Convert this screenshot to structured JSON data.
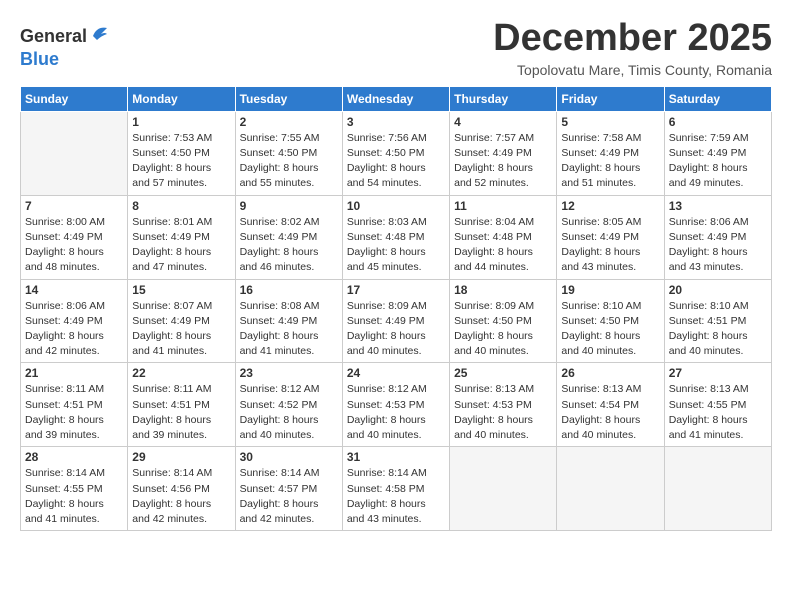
{
  "logo": {
    "general": "General",
    "blue": "Blue"
  },
  "title": "December 2025",
  "subtitle": "Topolovatu Mare, Timis County, Romania",
  "headers": [
    "Sunday",
    "Monday",
    "Tuesday",
    "Wednesday",
    "Thursday",
    "Friday",
    "Saturday"
  ],
  "weeks": [
    [
      {
        "day": "",
        "sunrise": "",
        "sunset": "",
        "daylight": ""
      },
      {
        "day": "1",
        "sunrise": "Sunrise: 7:53 AM",
        "sunset": "Sunset: 4:50 PM",
        "daylight": "Daylight: 8 hours and 57 minutes."
      },
      {
        "day": "2",
        "sunrise": "Sunrise: 7:55 AM",
        "sunset": "Sunset: 4:50 PM",
        "daylight": "Daylight: 8 hours and 55 minutes."
      },
      {
        "day": "3",
        "sunrise": "Sunrise: 7:56 AM",
        "sunset": "Sunset: 4:50 PM",
        "daylight": "Daylight: 8 hours and 54 minutes."
      },
      {
        "day": "4",
        "sunrise": "Sunrise: 7:57 AM",
        "sunset": "Sunset: 4:49 PM",
        "daylight": "Daylight: 8 hours and 52 minutes."
      },
      {
        "day": "5",
        "sunrise": "Sunrise: 7:58 AM",
        "sunset": "Sunset: 4:49 PM",
        "daylight": "Daylight: 8 hours and 51 minutes."
      },
      {
        "day": "6",
        "sunrise": "Sunrise: 7:59 AM",
        "sunset": "Sunset: 4:49 PM",
        "daylight": "Daylight: 8 hours and 49 minutes."
      }
    ],
    [
      {
        "day": "7",
        "sunrise": "Sunrise: 8:00 AM",
        "sunset": "Sunset: 4:49 PM",
        "daylight": "Daylight: 8 hours and 48 minutes."
      },
      {
        "day": "8",
        "sunrise": "Sunrise: 8:01 AM",
        "sunset": "Sunset: 4:49 PM",
        "daylight": "Daylight: 8 hours and 47 minutes."
      },
      {
        "day": "9",
        "sunrise": "Sunrise: 8:02 AM",
        "sunset": "Sunset: 4:49 PM",
        "daylight": "Daylight: 8 hours and 46 minutes."
      },
      {
        "day": "10",
        "sunrise": "Sunrise: 8:03 AM",
        "sunset": "Sunset: 4:48 PM",
        "daylight": "Daylight: 8 hours and 45 minutes."
      },
      {
        "day": "11",
        "sunrise": "Sunrise: 8:04 AM",
        "sunset": "Sunset: 4:48 PM",
        "daylight": "Daylight: 8 hours and 44 minutes."
      },
      {
        "day": "12",
        "sunrise": "Sunrise: 8:05 AM",
        "sunset": "Sunset: 4:49 PM",
        "daylight": "Daylight: 8 hours and 43 minutes."
      },
      {
        "day": "13",
        "sunrise": "Sunrise: 8:06 AM",
        "sunset": "Sunset: 4:49 PM",
        "daylight": "Daylight: 8 hours and 43 minutes."
      }
    ],
    [
      {
        "day": "14",
        "sunrise": "Sunrise: 8:06 AM",
        "sunset": "Sunset: 4:49 PM",
        "daylight": "Daylight: 8 hours and 42 minutes."
      },
      {
        "day": "15",
        "sunrise": "Sunrise: 8:07 AM",
        "sunset": "Sunset: 4:49 PM",
        "daylight": "Daylight: 8 hours and 41 minutes."
      },
      {
        "day": "16",
        "sunrise": "Sunrise: 8:08 AM",
        "sunset": "Sunset: 4:49 PM",
        "daylight": "Daylight: 8 hours and 41 minutes."
      },
      {
        "day": "17",
        "sunrise": "Sunrise: 8:09 AM",
        "sunset": "Sunset: 4:49 PM",
        "daylight": "Daylight: 8 hours and 40 minutes."
      },
      {
        "day": "18",
        "sunrise": "Sunrise: 8:09 AM",
        "sunset": "Sunset: 4:50 PM",
        "daylight": "Daylight: 8 hours and 40 minutes."
      },
      {
        "day": "19",
        "sunrise": "Sunrise: 8:10 AM",
        "sunset": "Sunset: 4:50 PM",
        "daylight": "Daylight: 8 hours and 40 minutes."
      },
      {
        "day": "20",
        "sunrise": "Sunrise: 8:10 AM",
        "sunset": "Sunset: 4:51 PM",
        "daylight": "Daylight: 8 hours and 40 minutes."
      }
    ],
    [
      {
        "day": "21",
        "sunrise": "Sunrise: 8:11 AM",
        "sunset": "Sunset: 4:51 PM",
        "daylight": "Daylight: 8 hours and 39 minutes."
      },
      {
        "day": "22",
        "sunrise": "Sunrise: 8:11 AM",
        "sunset": "Sunset: 4:51 PM",
        "daylight": "Daylight: 8 hours and 39 minutes."
      },
      {
        "day": "23",
        "sunrise": "Sunrise: 8:12 AM",
        "sunset": "Sunset: 4:52 PM",
        "daylight": "Daylight: 8 hours and 40 minutes."
      },
      {
        "day": "24",
        "sunrise": "Sunrise: 8:12 AM",
        "sunset": "Sunset: 4:53 PM",
        "daylight": "Daylight: 8 hours and 40 minutes."
      },
      {
        "day": "25",
        "sunrise": "Sunrise: 8:13 AM",
        "sunset": "Sunset: 4:53 PM",
        "daylight": "Daylight: 8 hours and 40 minutes."
      },
      {
        "day": "26",
        "sunrise": "Sunrise: 8:13 AM",
        "sunset": "Sunset: 4:54 PM",
        "daylight": "Daylight: 8 hours and 40 minutes."
      },
      {
        "day": "27",
        "sunrise": "Sunrise: 8:13 AM",
        "sunset": "Sunset: 4:55 PM",
        "daylight": "Daylight: 8 hours and 41 minutes."
      }
    ],
    [
      {
        "day": "28",
        "sunrise": "Sunrise: 8:14 AM",
        "sunset": "Sunset: 4:55 PM",
        "daylight": "Daylight: 8 hours and 41 minutes."
      },
      {
        "day": "29",
        "sunrise": "Sunrise: 8:14 AM",
        "sunset": "Sunset: 4:56 PM",
        "daylight": "Daylight: 8 hours and 42 minutes."
      },
      {
        "day": "30",
        "sunrise": "Sunrise: 8:14 AM",
        "sunset": "Sunset: 4:57 PM",
        "daylight": "Daylight: 8 hours and 42 minutes."
      },
      {
        "day": "31",
        "sunrise": "Sunrise: 8:14 AM",
        "sunset": "Sunset: 4:58 PM",
        "daylight": "Daylight: 8 hours and 43 minutes."
      },
      {
        "day": "",
        "sunrise": "",
        "sunset": "",
        "daylight": ""
      },
      {
        "day": "",
        "sunrise": "",
        "sunset": "",
        "daylight": ""
      },
      {
        "day": "",
        "sunrise": "",
        "sunset": "",
        "daylight": ""
      }
    ]
  ]
}
